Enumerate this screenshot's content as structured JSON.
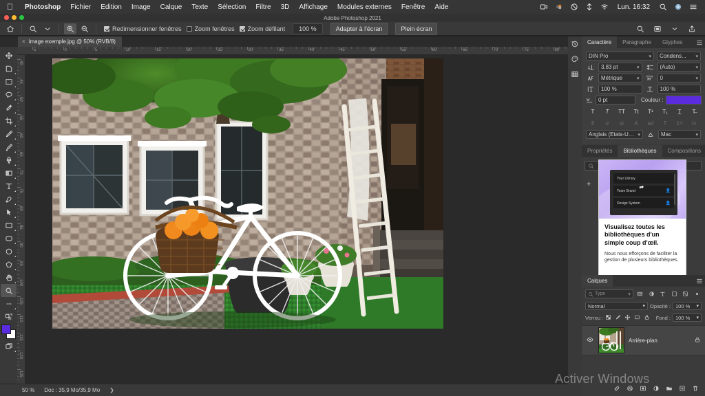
{
  "macbar": {
    "apple": "apple-logo",
    "items": [
      {
        "label": "Photoshop",
        "bold": true
      },
      {
        "label": "Fichier",
        "bold": false
      },
      {
        "label": "Edition",
        "bold": false
      },
      {
        "label": "Image",
        "bold": false
      },
      {
        "label": "Calque",
        "bold": false
      },
      {
        "label": "Texte",
        "bold": false
      },
      {
        "label": "Sélection",
        "bold": false
      },
      {
        "label": "Filtre",
        "bold": false
      },
      {
        "label": "3D",
        "bold": false
      },
      {
        "label": "Affichage",
        "bold": false
      },
      {
        "label": "Modules externes",
        "bold": false
      },
      {
        "label": "Fenêtre",
        "bold": false
      },
      {
        "label": "Aide",
        "bold": false
      }
    ],
    "status_icons": [
      "screen-record-icon",
      "dropbox-icon",
      "do-not-disturb-icon",
      "shortcuts-icon",
      "wifi-icon"
    ],
    "clock": "Lun. 16:32",
    "right_icons": [
      "search-icon",
      "siri-icon",
      "control-center-icon"
    ]
  },
  "window": {
    "title": "Adobe Photoshop 2021"
  },
  "options_bar": {
    "home_icon": "home-icon",
    "tool_icon": "zoom-tool-icon",
    "zoom_in_label": "zoom-in-icon",
    "zoom_out_label": "zoom-out-icon",
    "checkboxes": [
      {
        "label": "Redimensionner fenêtres",
        "checked": true
      },
      {
        "label": "Zoom fenêtres",
        "checked": false
      },
      {
        "label": "Zoom défilant",
        "checked": true
      }
    ],
    "zoom_value": "100 %",
    "buttons": [
      "Adapter à l'écran",
      "Plein écran"
    ],
    "right_icons": [
      "search-icon",
      "workspace-icon",
      "share-icon"
    ]
  },
  "document_tab": {
    "label": "image exemple.jpg @ 50% (RVB/8)",
    "close": "×"
  },
  "toolbar": {
    "tools": [
      {
        "name": "move-tool",
        "active": false
      },
      {
        "name": "artboard-tool",
        "active": false
      },
      {
        "name": "marquee-tool",
        "active": false
      },
      {
        "name": "lasso-tool",
        "active": false
      },
      {
        "name": "quick-selection-tool",
        "active": false
      },
      {
        "name": "crop-tool",
        "active": false
      },
      {
        "name": "eyedropper-tool",
        "active": false
      },
      {
        "name": "brush-tool",
        "active": false
      },
      {
        "name": "clone-stamp-tool",
        "active": false
      },
      {
        "name": "gradient-tool",
        "active": false
      },
      {
        "name": "type-tool",
        "active": false
      },
      {
        "name": "pen-tool",
        "active": false
      },
      {
        "name": "path-selection-tool",
        "active": false
      },
      {
        "name": "rectangle-tool",
        "active": false
      },
      {
        "name": "rounded-rectangle-tool",
        "active": false
      },
      {
        "name": "ellipse-tool",
        "active": false
      },
      {
        "name": "polygon-tool",
        "active": false
      },
      {
        "name": "hand-tool",
        "active": false
      },
      {
        "name": "zoom-tool",
        "active": true
      },
      {
        "name": "edit-toolbar-tool",
        "active": false
      }
    ],
    "foreground_color": "#5b2be0",
    "background_color": "#ffffff"
  },
  "rulers": {
    "horizontal": [
      "5",
      "0",
      "5",
      "10",
      "15",
      "20",
      "25",
      "30",
      "35",
      "40",
      "45",
      "50",
      "55",
      "60",
      "65",
      "70",
      "75",
      "80"
    ],
    "vertical": [
      "40",
      "45",
      "50",
      "55",
      "60",
      "65",
      "70",
      "75",
      "80",
      "85",
      "90",
      "95",
      "100",
      "105",
      "110",
      "115",
      "120",
      "125"
    ],
    "unit_hint": "cm"
  },
  "status_bar": {
    "zoom": "50 %",
    "doc": "Doc : 35,9 Mo/35,9 Mo",
    "arrow": "❯"
  },
  "dock_strip": {
    "icons": [
      "history-icon",
      "swatches-icon",
      "properties-grid-icon"
    ]
  },
  "character_panel": {
    "tabs": [
      {
        "label": "Caractère",
        "active": true
      },
      {
        "label": "Paragraphe",
        "active": false
      },
      {
        "label": "Glyphes",
        "active": false
      }
    ],
    "menu_icon": "panel-menu-icon",
    "font_family": "DIN Pro",
    "font_style": "Condens...",
    "size_icon": "font-size-icon",
    "size": "3,83 pt",
    "leading_icon": "leading-icon",
    "leading": "(Auto)",
    "kerning_icon": "kerning-icon",
    "kerning": "Métrique",
    "tracking_icon": "tracking-icon",
    "tracking": "0",
    "vertical_scale_icon": "vertical-scale-icon",
    "vertical_scale": "100 %",
    "horizontal_scale_icon": "horizontal-scale-icon",
    "horizontal_scale": "100 %",
    "baseline_icon": "baseline-shift-icon",
    "baseline_shift": "0 pt",
    "color_label": "Couleur :",
    "color_value": "#5b2be0",
    "style_buttons_row1": [
      "T",
      "T",
      "TT",
      "Tt",
      "T¹",
      "T₁",
      "T̲",
      "T̶"
    ],
    "style_buttons_row2": [
      "fi",
      "ơ",
      "st",
      "A",
      "ad",
      "T",
      "1ˢᵗ",
      "½"
    ],
    "language": "Anglais (Etats-Unis)",
    "antialias_icon": "anti-alias-icon",
    "antialias": "Mac"
  },
  "libraries_panel": {
    "tabs": [
      {
        "label": "Propriétés",
        "active": false
      },
      {
        "label": "Bibliothèques",
        "active": true
      },
      {
        "label": "Compositions",
        "active": false
      }
    ],
    "menu_icon": "panel-menu-icon",
    "search_placeholder": "",
    "search_icon": "search-icon",
    "add_icon": "plus-icon",
    "promo": {
      "items": [
        "Your Library",
        "Team Brand",
        "Design System"
      ],
      "person_icon": "person-icon",
      "cursor_icon": "cursor-icon",
      "heading": "Visualisez toutes les bibliothèques d'un simple coup d'œil.",
      "body": "Nous nous efforçons de faciliter la gestion de plusieurs bibliothèques."
    }
  },
  "layers_panel": {
    "tabs": [
      {
        "label": "Calques",
        "active": true
      }
    ],
    "menu_icon": "panel-menu-icon",
    "filter_placeholder": "Type",
    "filter_icons": [
      "pixel-filter-icon",
      "adjustment-filter-icon",
      "type-filter-icon",
      "shape-filter-icon",
      "smart-object-filter-icon"
    ],
    "filter_toggle_icon": "filter-toggle-icon",
    "blend_mode": "Normal",
    "opacity_label": "Opacité :",
    "opacity_value": "100 %",
    "lock_label": "Verrou :",
    "lock_icons": [
      "lock-transparency-icon",
      "lock-paint-icon",
      "lock-position-icon",
      "lock-artboard-icon",
      "lock-all-icon"
    ],
    "fill_label": "Fond :",
    "fill_value": "100 %",
    "layers": [
      {
        "visible_icon": "eye-icon",
        "name": "Arrière-plan",
        "lock_icon": "lock-icon",
        "thumbnail": "bicycle-house-photo"
      }
    ],
    "footer_icons": [
      "link-icon",
      "fx-icon",
      "mask-icon",
      "adjustment-icon",
      "folder-icon",
      "new-layer-icon",
      "delete-icon"
    ]
  },
  "watermark": {
    "text": "Activer Windows"
  }
}
